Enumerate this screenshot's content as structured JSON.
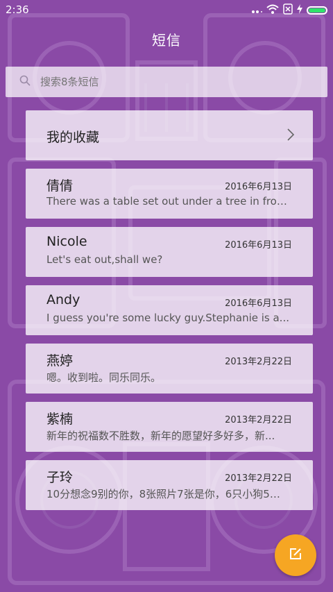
{
  "status_bar": {
    "time": "2:36",
    "battery_color": "#2fe36a"
  },
  "header": {
    "title": "短信"
  },
  "search": {
    "placeholder": "搜索8条短信",
    "icon": "search-icon"
  },
  "favorites": {
    "label": "我的收藏",
    "icon": "chevron-right-icon"
  },
  "messages": [
    {
      "name": "倩倩",
      "date": "2016年6月13日",
      "preview": "There was a table set out under a tree in front..."
    },
    {
      "name": "Nicole",
      "date": "2016年6月13日",
      "preview": "Let's eat out,shall we?"
    },
    {
      "name": "Andy",
      "date": "2016年6月13日",
      "preview": "I guess you're some lucky guy.Stephanie is a..."
    },
    {
      "name": "燕婷",
      "date": "2013年2月22日",
      "preview": "嗯。收到啦。同乐同乐。"
    },
    {
      "name": "紫楠",
      "date": "2013年2月22日",
      "preview": "新年的祝福数不胜数，新年的愿望好多好多，新..."
    },
    {
      "name": "子玲",
      "date": "2013年2月22日",
      "preview": "10分想念9别的你，8张照片7张是你，6只小狗5只..."
    }
  ],
  "compose": {
    "icon": "compose-icon",
    "color": "#f6a623"
  },
  "theme": {
    "background": "#8a4aa6"
  }
}
